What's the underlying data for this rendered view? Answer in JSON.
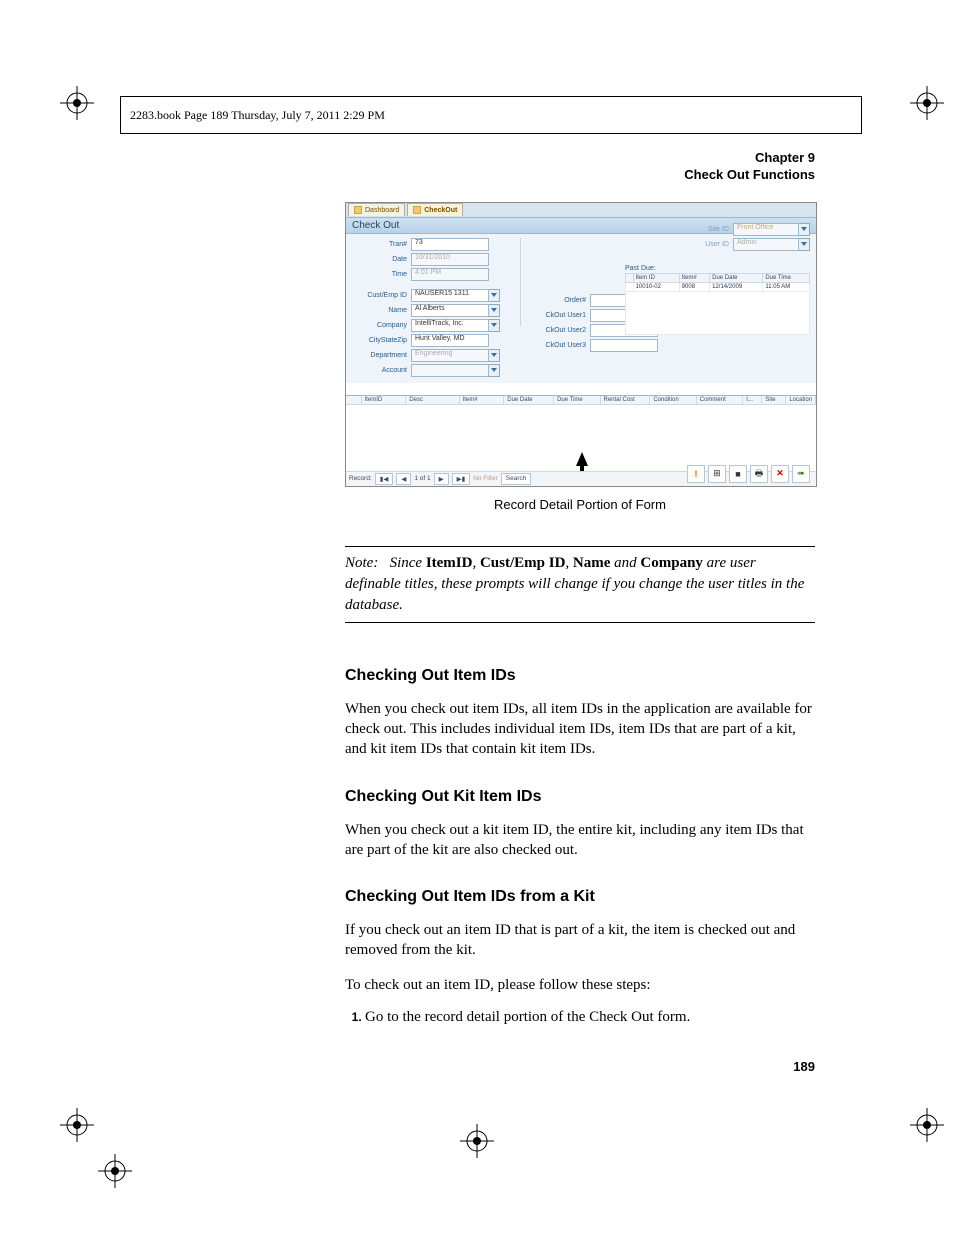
{
  "header": {
    "running": "2283.book  Page 189  Thursday, July 7, 2011  2:29 PM",
    "chapter": "Chapter 9",
    "title": "Check Out Functions"
  },
  "screenshot": {
    "tabs": {
      "dashboard": "Dashboard",
      "checkout": "CheckOut"
    },
    "panel_title": "Check Out",
    "left_labels": {
      "tran": "Tran#",
      "date": "Date",
      "time": "Time",
      "cust": "Cust/Emp ID",
      "name": "Name",
      "company": "Company",
      "csz": "CityStateZip",
      "dept": "Department",
      "account": "Account"
    },
    "left_values": {
      "tran": "73",
      "date": "10/31/2010",
      "time": "4:01 PM",
      "cust": "NAUSER15 1311",
      "name": "Al Alberts",
      "company": "IntelliTrack, Inc.",
      "csz": "Hunt Valley, MD",
      "dept": "Engineering",
      "account": ""
    },
    "mid_labels": {
      "order": "Order#",
      "u1": "CkOut User1",
      "u2": "CkOut User2",
      "u3": "CkOut User3"
    },
    "top_right": {
      "site_lbl": "Site ID",
      "site_val": "",
      "user_lbl": "User ID",
      "user_val": "Admin"
    },
    "past_due_title": "Past Due:",
    "pd_headers": [
      "",
      "Item ID",
      "Item#",
      "Due Date",
      "Due Time"
    ],
    "pd_row": [
      "",
      "10010-02",
      "9008",
      "12/14/2009",
      "11:05 AM"
    ],
    "grid_headers": [
      "",
      "ItemID",
      "Desc",
      "Item#",
      "Due Date",
      "Due Time",
      "Rental Cost",
      "Condition",
      "Comment",
      "I...",
      "Site",
      "Location"
    ],
    "nav": {
      "record_label": "Record:",
      "pos": "1 of 1",
      "nofilter": "No Filter",
      "search": "Search"
    },
    "footer_icons": [
      "!",
      "⊞",
      "■",
      "🖶",
      "✕",
      "➠"
    ]
  },
  "caption": "Record Detail Portion of Form",
  "note": {
    "label": "Note:",
    "t1": "Since ",
    "b1": "ItemID",
    "c1": ", ",
    "b2": "Cust/Emp ID",
    "c2": ", ",
    "b3": "Name",
    "c3": " and ",
    "b4": "Company",
    "t2": " are user definable titles, these prompts will change if you change the user titles in the database."
  },
  "s1": {
    "h": "Checking Out Item IDs",
    "p": "When you check out item IDs, all item IDs in the application are available for check out. This includes individual item IDs, item IDs that are part of a kit, and kit item IDs that contain kit item IDs."
  },
  "s2": {
    "h": "Checking Out Kit Item IDs",
    "p": "When you check out a kit item ID, the entire kit, including any item IDs that are part of the kit are also checked out."
  },
  "s3": {
    "h": "Checking Out Item IDs from a Kit",
    "p1": "If you check out an item ID that is part of a kit, the item is checked out and removed from the kit.",
    "p2": "To check out an item ID, please follow these steps:",
    "step1": "Go to the record detail portion of the Check Out form."
  },
  "page_number": "189"
}
